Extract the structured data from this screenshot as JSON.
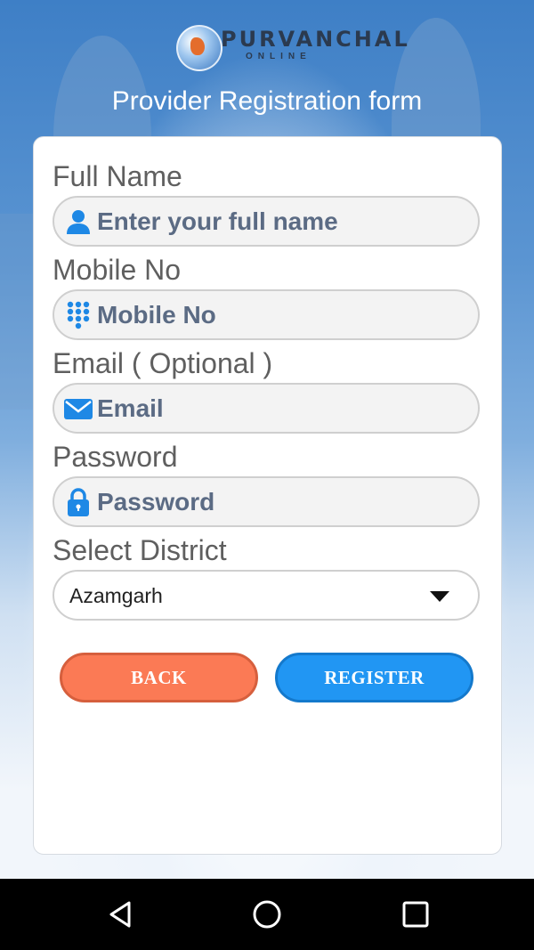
{
  "header": {
    "logo_title": "PURVANCHAL",
    "logo_subtitle": "ONLINE",
    "page_title": "Provider Registration form"
  },
  "form": {
    "full_name": {
      "label": "Full Name",
      "placeholder": "Enter your full name",
      "icon": "person-icon"
    },
    "mobile": {
      "label": "Mobile No",
      "placeholder": "Mobile No",
      "icon": "dialpad-icon"
    },
    "email": {
      "label": "Email ( Optional )",
      "placeholder": "Email",
      "icon": "envelope-icon"
    },
    "password": {
      "label": "Password",
      "placeholder": "Password",
      "icon": "lock-icon"
    },
    "district": {
      "label": "Select District",
      "selected": "Azamgarh"
    }
  },
  "buttons": {
    "back": "BACK",
    "register": "REGISTER"
  },
  "colors": {
    "accent_blue": "#2196f3",
    "back_orange": "#fb7a55",
    "icon_blue": "#1e88e5"
  },
  "navbar": {
    "icons": [
      "back-triangle-icon",
      "home-circle-icon",
      "recents-square-icon"
    ]
  }
}
